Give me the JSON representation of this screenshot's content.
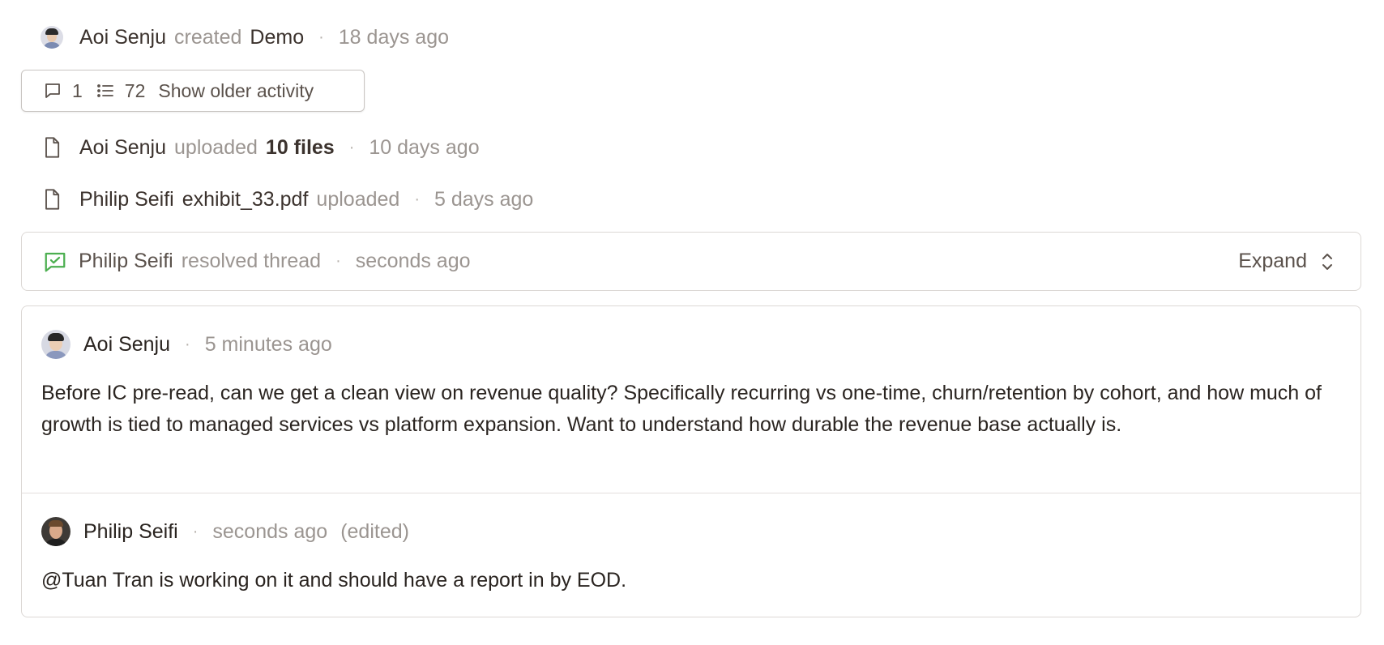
{
  "activity": [
    {
      "user": "Aoi Senju",
      "action": "created",
      "object": "Demo",
      "time": "18 days ago"
    },
    {
      "user": "Aoi Senju",
      "action": "uploaded",
      "object": "10 files",
      "time": "10 days ago"
    },
    {
      "user": "Philip Seifi",
      "object": "exhibit_33.pdf",
      "action": "uploaded",
      "time": "5 days ago"
    }
  ],
  "older": {
    "comment_count": "1",
    "activity_count": "72",
    "label": "Show older activity"
  },
  "resolved": {
    "user": "Philip Seifi",
    "action": "resolved thread",
    "time": "seconds ago",
    "expand_label": "Expand"
  },
  "thread": {
    "comments": [
      {
        "user": "Aoi Senju",
        "time": "5 minutes ago",
        "text": "Before IC pre-read, can we get a clean view on revenue quality? Specifically recurring vs one-time, churn/retention by cohort, and how much of growth is tied to managed services vs platform expansion. Want to understand how durable the revenue base actually is."
      },
      {
        "user": "Philip Seifi",
        "time": "seconds ago",
        "edited": "(edited)",
        "mention": "@Tuan Tran",
        "text": " is working on it and should have a report in by EOD."
      }
    ]
  },
  "colors": {
    "resolved_icon": "#4caf50",
    "muted_text": "#9b9591"
  }
}
